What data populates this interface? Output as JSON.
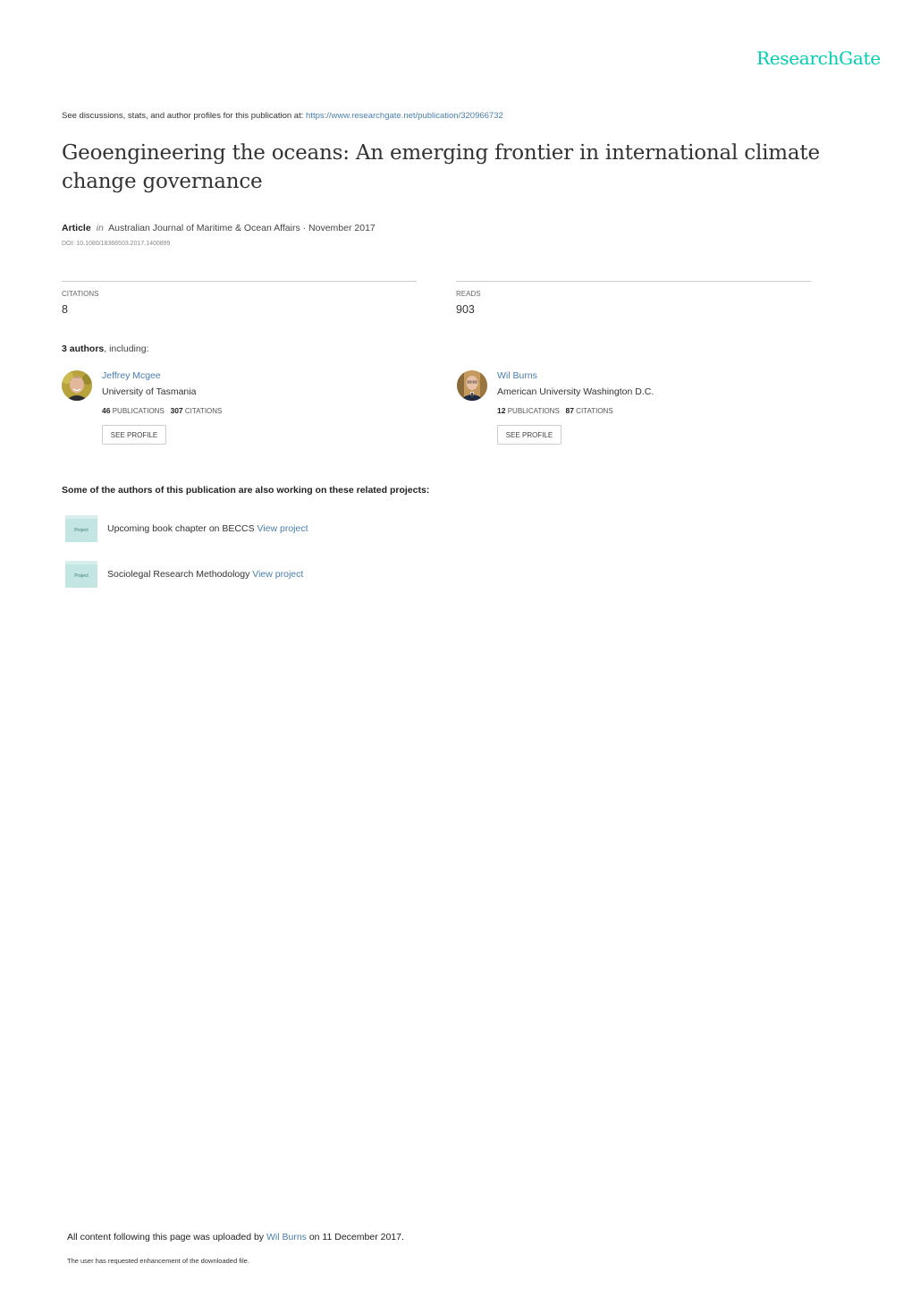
{
  "brand": "ResearchGate",
  "header": {
    "see_discussions": "See discussions, stats, and author profiles for this publication at: ",
    "publication_url": "https://www.researchgate.net/publication/320966732"
  },
  "publication": {
    "title": "Geoengineering the oceans: An emerging frontier in international climate change governance",
    "type": "Article",
    "in_label": "in",
    "journal_date": "Australian Journal of Maritime & Ocean Affairs · November 2017",
    "doi": "DOI: 10.1080/18366503.2017.1400899"
  },
  "stats": {
    "citations_label": "CITATIONS",
    "citations_value": "8",
    "reads_label": "READS",
    "reads_value": "903"
  },
  "authors_header": {
    "count": "3 authors",
    "suffix": ", including:"
  },
  "authors": [
    {
      "name": "Jeffrey Mcgee",
      "institution": "University of Tasmania",
      "publications": "46",
      "publications_label": "PUBLICATIONS",
      "citations": "307",
      "citations_label": "CITATIONS",
      "button": "SEE PROFILE"
    },
    {
      "name": "Wil Burns",
      "institution": "American University Washington D.C.",
      "publications": "12",
      "publications_label": "PUBLICATIONS",
      "citations": "87",
      "citations_label": "CITATIONS",
      "button": "SEE PROFILE"
    }
  ],
  "projects_header": "Some of the authors of this publication are also working on these related projects:",
  "projects": [
    {
      "icon_label": "Project",
      "title": "Upcoming book chapter on BECCS",
      "link": "View project"
    },
    {
      "icon_label": "Project",
      "title": "Sociolegal Research Methodology",
      "link": "View project"
    }
  ],
  "footer": {
    "uploaded_prefix": "All content following this page was uploaded by ",
    "uploader": "Wil Burns",
    "uploaded_suffix": " on 11 December 2017.",
    "note": "The user has requested enhancement of the downloaded file."
  }
}
